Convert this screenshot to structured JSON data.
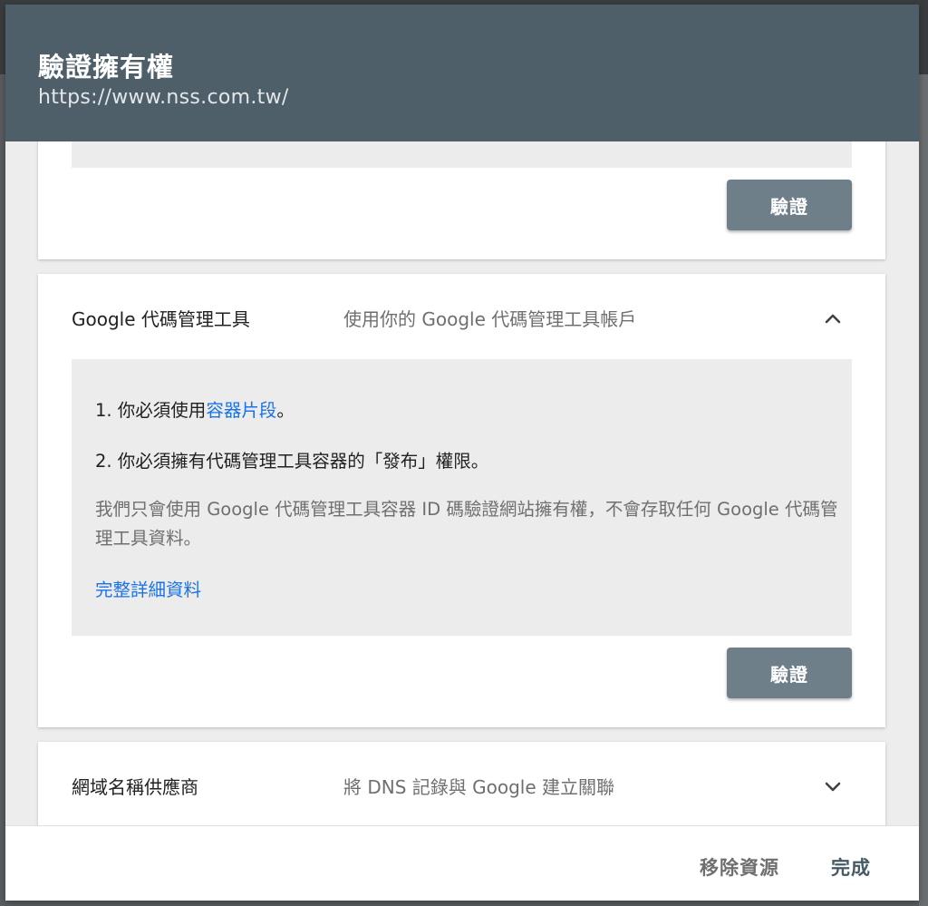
{
  "dialog": {
    "title": "驗證擁有權",
    "subtitle": "https://www.nss.com.tw/"
  },
  "methods": [
    {
      "verify_label": "驗證"
    },
    {
      "name": "Google 代碼管理工具",
      "description": "使用你的 Google 代碼管理工具帳戶",
      "expanded": true,
      "chevron_icon": "chevron-up-icon",
      "step1_prefix": "1. 你必須使用",
      "step1_link": "容器片段",
      "step1_suffix": "。",
      "step2": "2. 你必須擁有代碼管理工具容器的「發布」權限。",
      "note": "我們只會使用 Google 代碼管理工具容器 ID 碼驗證網站擁有權，不會存取任何 Google 代碼管理工具資料。",
      "details_link": "完整詳細資料",
      "verify_label": "驗證"
    },
    {
      "name": "網域名稱供應商",
      "description": "將 DNS 記錄與 Google 建立關聯",
      "expanded": false,
      "chevron_icon": "chevron-down-icon"
    }
  ],
  "footer": {
    "remove_label": "移除資源",
    "done_label": "完成"
  },
  "colors": {
    "header_bg": "#4e5f6a",
    "verify_button": "#6f7f89",
    "link": "#1a73e8",
    "done_text": "#455a64"
  }
}
